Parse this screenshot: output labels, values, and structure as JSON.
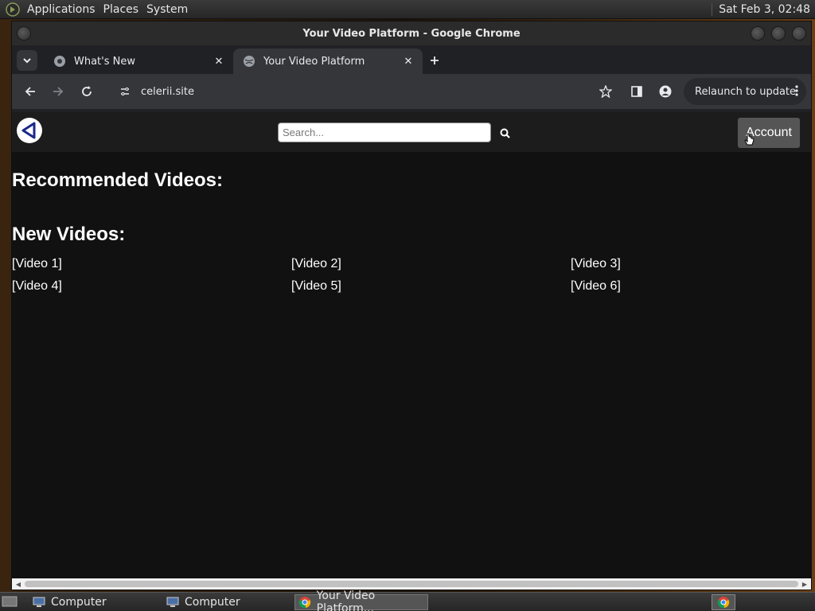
{
  "top_panel": {
    "menus": [
      "Applications",
      "Places",
      "System"
    ],
    "clock": "Sat Feb  3, 02:48"
  },
  "window": {
    "title": "Your Video Platform - Google Chrome"
  },
  "tabs": [
    {
      "title": "What's New",
      "active": false
    },
    {
      "title": "Your Video Platform",
      "active": true
    }
  ],
  "toolbar": {
    "url": "celerii.site",
    "relaunch_label": "Relaunch to update"
  },
  "site": {
    "search_placeholder": "Search...",
    "account_label": "Account",
    "recommended_heading": "Recommended Videos:",
    "new_heading": "New Videos:",
    "videos": [
      "[Video 1]",
      "[Video 2]",
      "[Video 3]",
      "[Video 4]",
      "[Video 5]",
      "[Video 6]"
    ]
  },
  "taskbar": {
    "items": [
      "Computer",
      "Computer",
      "Your Video Platform..."
    ]
  },
  "colors": {
    "page_bg": "#111111",
    "header_bg": "#1c1c1c",
    "account_bg": "#555555",
    "logo_blue": "#1a2a8a"
  }
}
